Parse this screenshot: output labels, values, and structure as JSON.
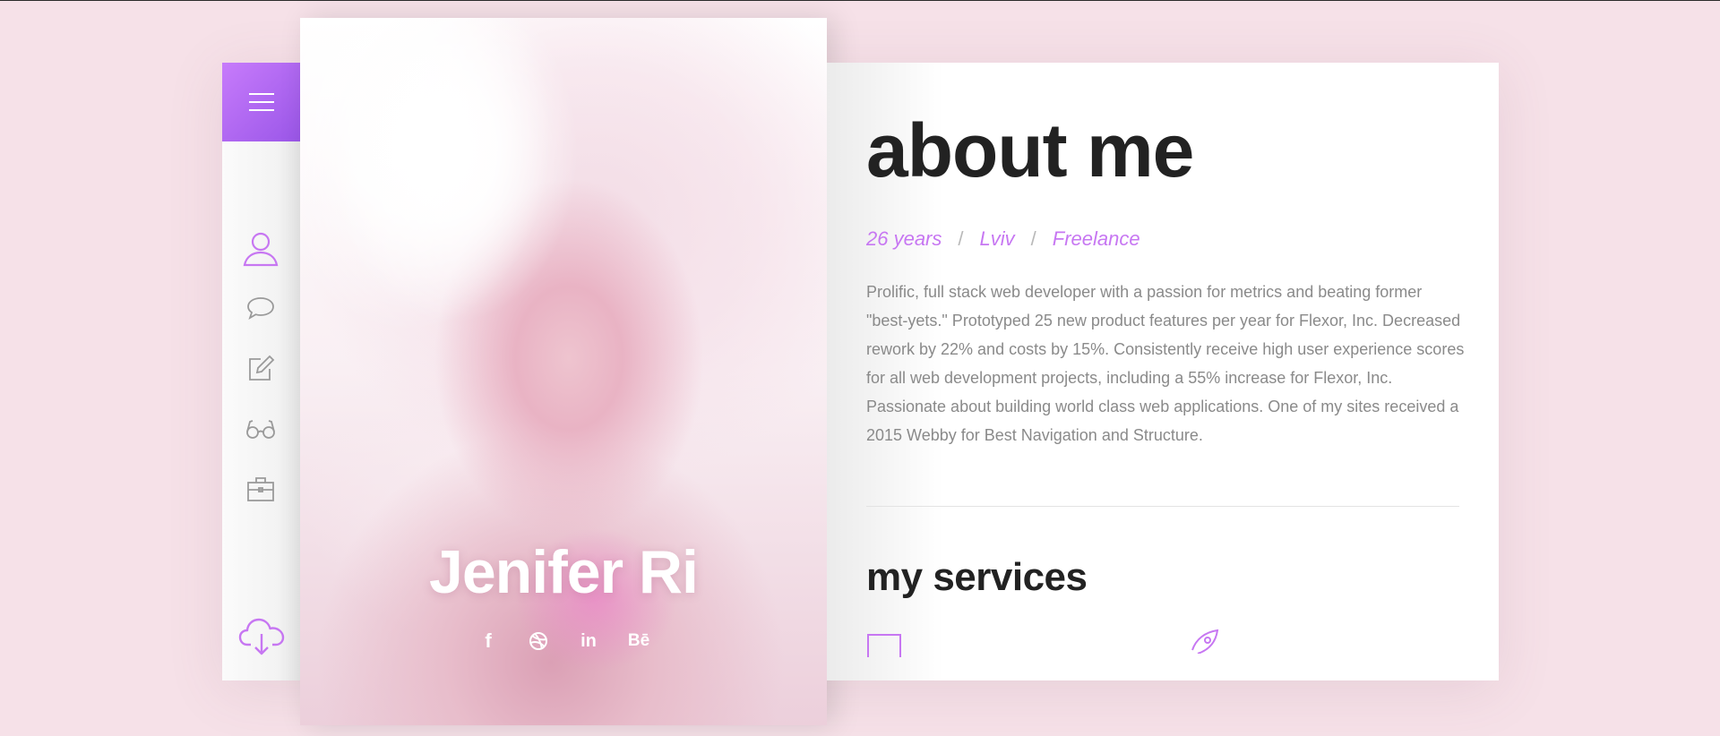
{
  "colors": {
    "background": "#f6e1e8",
    "accent": "#c777f2",
    "accent_gradient_end": "#9a56e8",
    "heading": "#222222",
    "body_text": "#8a8a8a",
    "icon_gray": "#9a9a9a"
  },
  "sidebar": {
    "menu_icon": "hamburger-icon",
    "items": [
      {
        "name": "about",
        "icon": "user-icon",
        "active": true
      },
      {
        "name": "chat",
        "icon": "speech-bubble-icon",
        "active": false
      },
      {
        "name": "blog",
        "icon": "edit-icon",
        "active": false
      },
      {
        "name": "resume",
        "icon": "glasses-icon",
        "active": false
      },
      {
        "name": "portfolio",
        "icon": "briefcase-icon",
        "active": false
      }
    ],
    "download_icon": "cloud-download-icon"
  },
  "profile": {
    "name": "Jenifer Ri",
    "social": [
      {
        "icon": "facebook-icon",
        "label": "f"
      },
      {
        "icon": "dribbble-icon",
        "label": ""
      },
      {
        "icon": "linkedin-icon",
        "label": "in"
      },
      {
        "icon": "behance-icon",
        "label": "Bē"
      }
    ]
  },
  "about": {
    "title": "about me",
    "age": "26 years",
    "city": "Lviv",
    "status": "Freelance",
    "separator": "/",
    "bio": "Prolific, full stack web developer with a passion for metrics and beating former \"best-yets.\" Prototyped 25 new product features per year for Flexor, Inc. Decreased rework by 22% and costs by 15%. Consistently receive high user experience scores for all web development projects, including a 55% increase for Flexor, Inc. Passionate about building world class web applications. One of my sites received a 2015 Webby for Best Navigation and Structure."
  },
  "services": {
    "title": "my services",
    "icons": [
      "monitor-icon",
      "rocket-icon"
    ]
  }
}
